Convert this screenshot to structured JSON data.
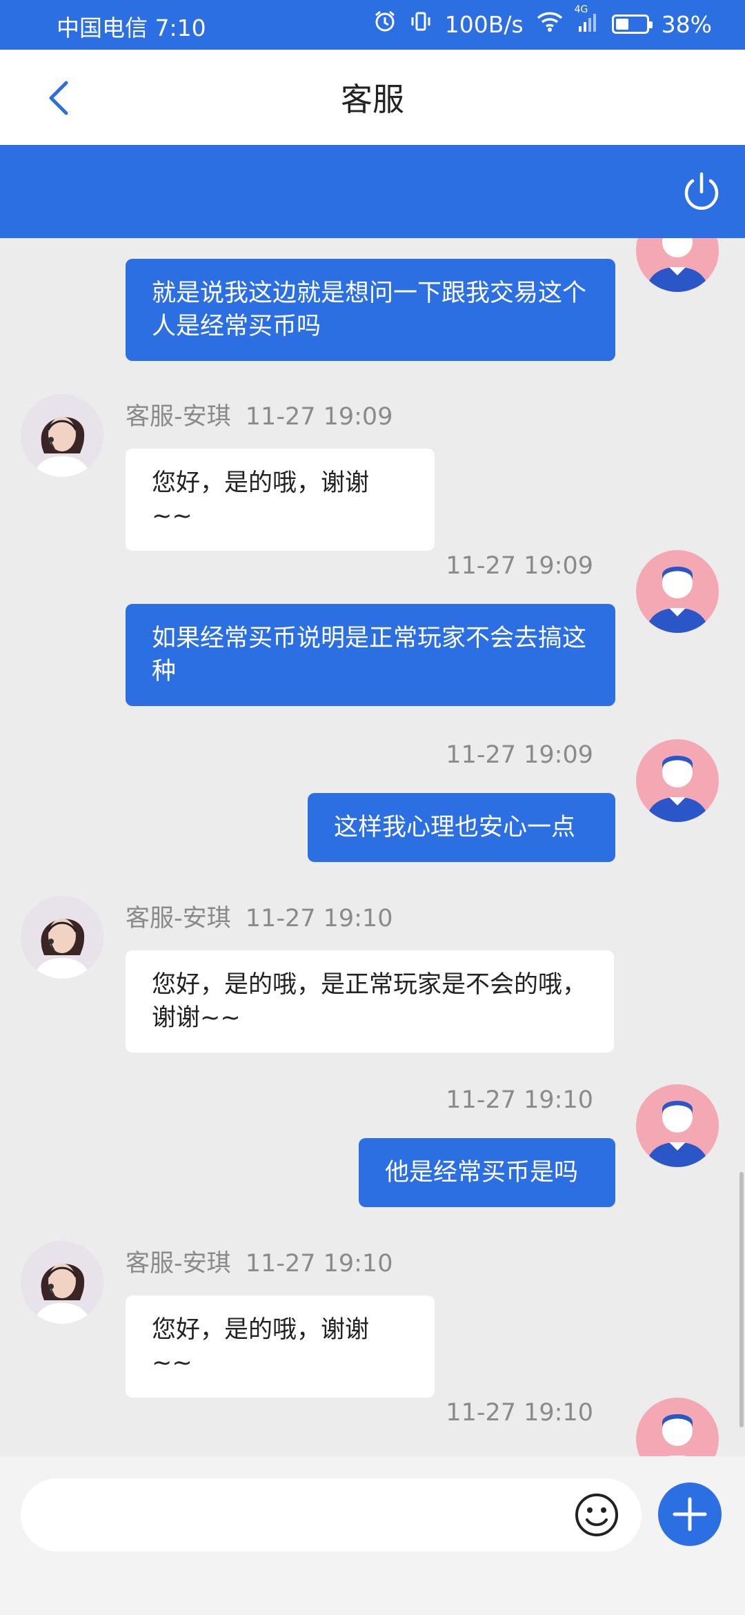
{
  "status_bar": {
    "carrier": "中国电信",
    "time": "7:10",
    "network_speed": "100B/s",
    "network_type": "4G",
    "battery": "38%",
    "battery_level": 0.38
  },
  "header": {
    "title": "客服",
    "back_icon": "chevron-left-icon"
  },
  "toolbar": {
    "power_icon": "power-icon"
  },
  "messages": [
    {
      "sender": "user",
      "time": "",
      "text": "就是说我这边就是想问一下跟我交易这个人是经常买币吗"
    },
    {
      "sender": "agent",
      "name": "客服-安琪",
      "time": "11-27 19:09",
      "text": "您好，是的哦，谢谢~~"
    },
    {
      "sender": "user",
      "time": "11-27 19:09",
      "text": "如果经常买币说明是正常玩家不会去搞这种"
    },
    {
      "sender": "user",
      "time": "11-27 19:09",
      "text": "这样我心理也安心一点"
    },
    {
      "sender": "agent",
      "name": "客服-安琪",
      "time": "11-27 19:10",
      "text": "您好，是的哦，是正常玩家是不会的哦，谢谢~~"
    },
    {
      "sender": "user",
      "time": "11-27 19:10",
      "text": "他是经常买币是吗"
    },
    {
      "sender": "agent",
      "name": "客服-安琪",
      "time": "11-27 19:10",
      "text": "您好，是的哦，谢谢~~"
    },
    {
      "sender": "user",
      "time": "11-27 19:10",
      "text": ""
    }
  ],
  "input": {
    "placeholder": "",
    "emoji_icon": "emoji-icon",
    "plus_icon": "plus-icon"
  },
  "colors": {
    "accent": "#2c6fe3",
    "background": "#ececec",
    "user_avatar_bg": "#f4a8b4"
  }
}
